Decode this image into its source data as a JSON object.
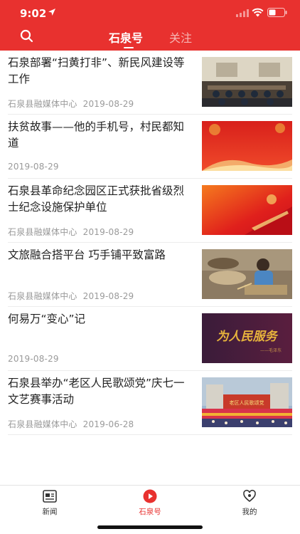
{
  "status_bar": {
    "time": "9:02"
  },
  "nav": {
    "tabs": [
      {
        "label": "石泉号",
        "active": true
      },
      {
        "label": "关注",
        "active": false
      }
    ]
  },
  "feed": {
    "items": [
      {
        "title": "石泉部署“扫黄打非”、新民风建设等工作",
        "source": "石泉县融媒体中心",
        "date": "2019-08-29"
      },
      {
        "title": "扶贫故事——他的手机号，村民都知道",
        "source": "",
        "date": "2019-08-29"
      },
      {
        "title": "石泉县革命纪念园区正式获批省级烈士纪念设施保护单位",
        "source": "石泉县融媒体中心",
        "date": "2019-08-29"
      },
      {
        "title": "文旅融合搭平台 巧手铺平致富路",
        "source": "石泉县融媒体中心",
        "date": "2019-08-29"
      },
      {
        "title": "何易万“变心”记",
        "source": "",
        "date": "2019-08-29",
        "thumb_text": "为人民服务",
        "thumb_signature": "——毛泽东"
      },
      {
        "title": "石泉县举办“老区人民歌颂党”庆七一文艺赛事活动",
        "source": "石泉县融媒体中心",
        "date": "2019-06-28",
        "thumb_text": "老区人民歌颂党"
      }
    ]
  },
  "tabbar": {
    "items": [
      {
        "label": "新闻",
        "icon": "news-icon",
        "active": false
      },
      {
        "label": "石泉号",
        "icon": "play-icon",
        "active": true
      },
      {
        "label": "我的",
        "icon": "profile-icon",
        "active": false
      }
    ]
  },
  "colors": {
    "brand_red": "#e8312f",
    "tab_inactive": "#f6b5b3",
    "meta_gray": "#9a9a9a"
  }
}
